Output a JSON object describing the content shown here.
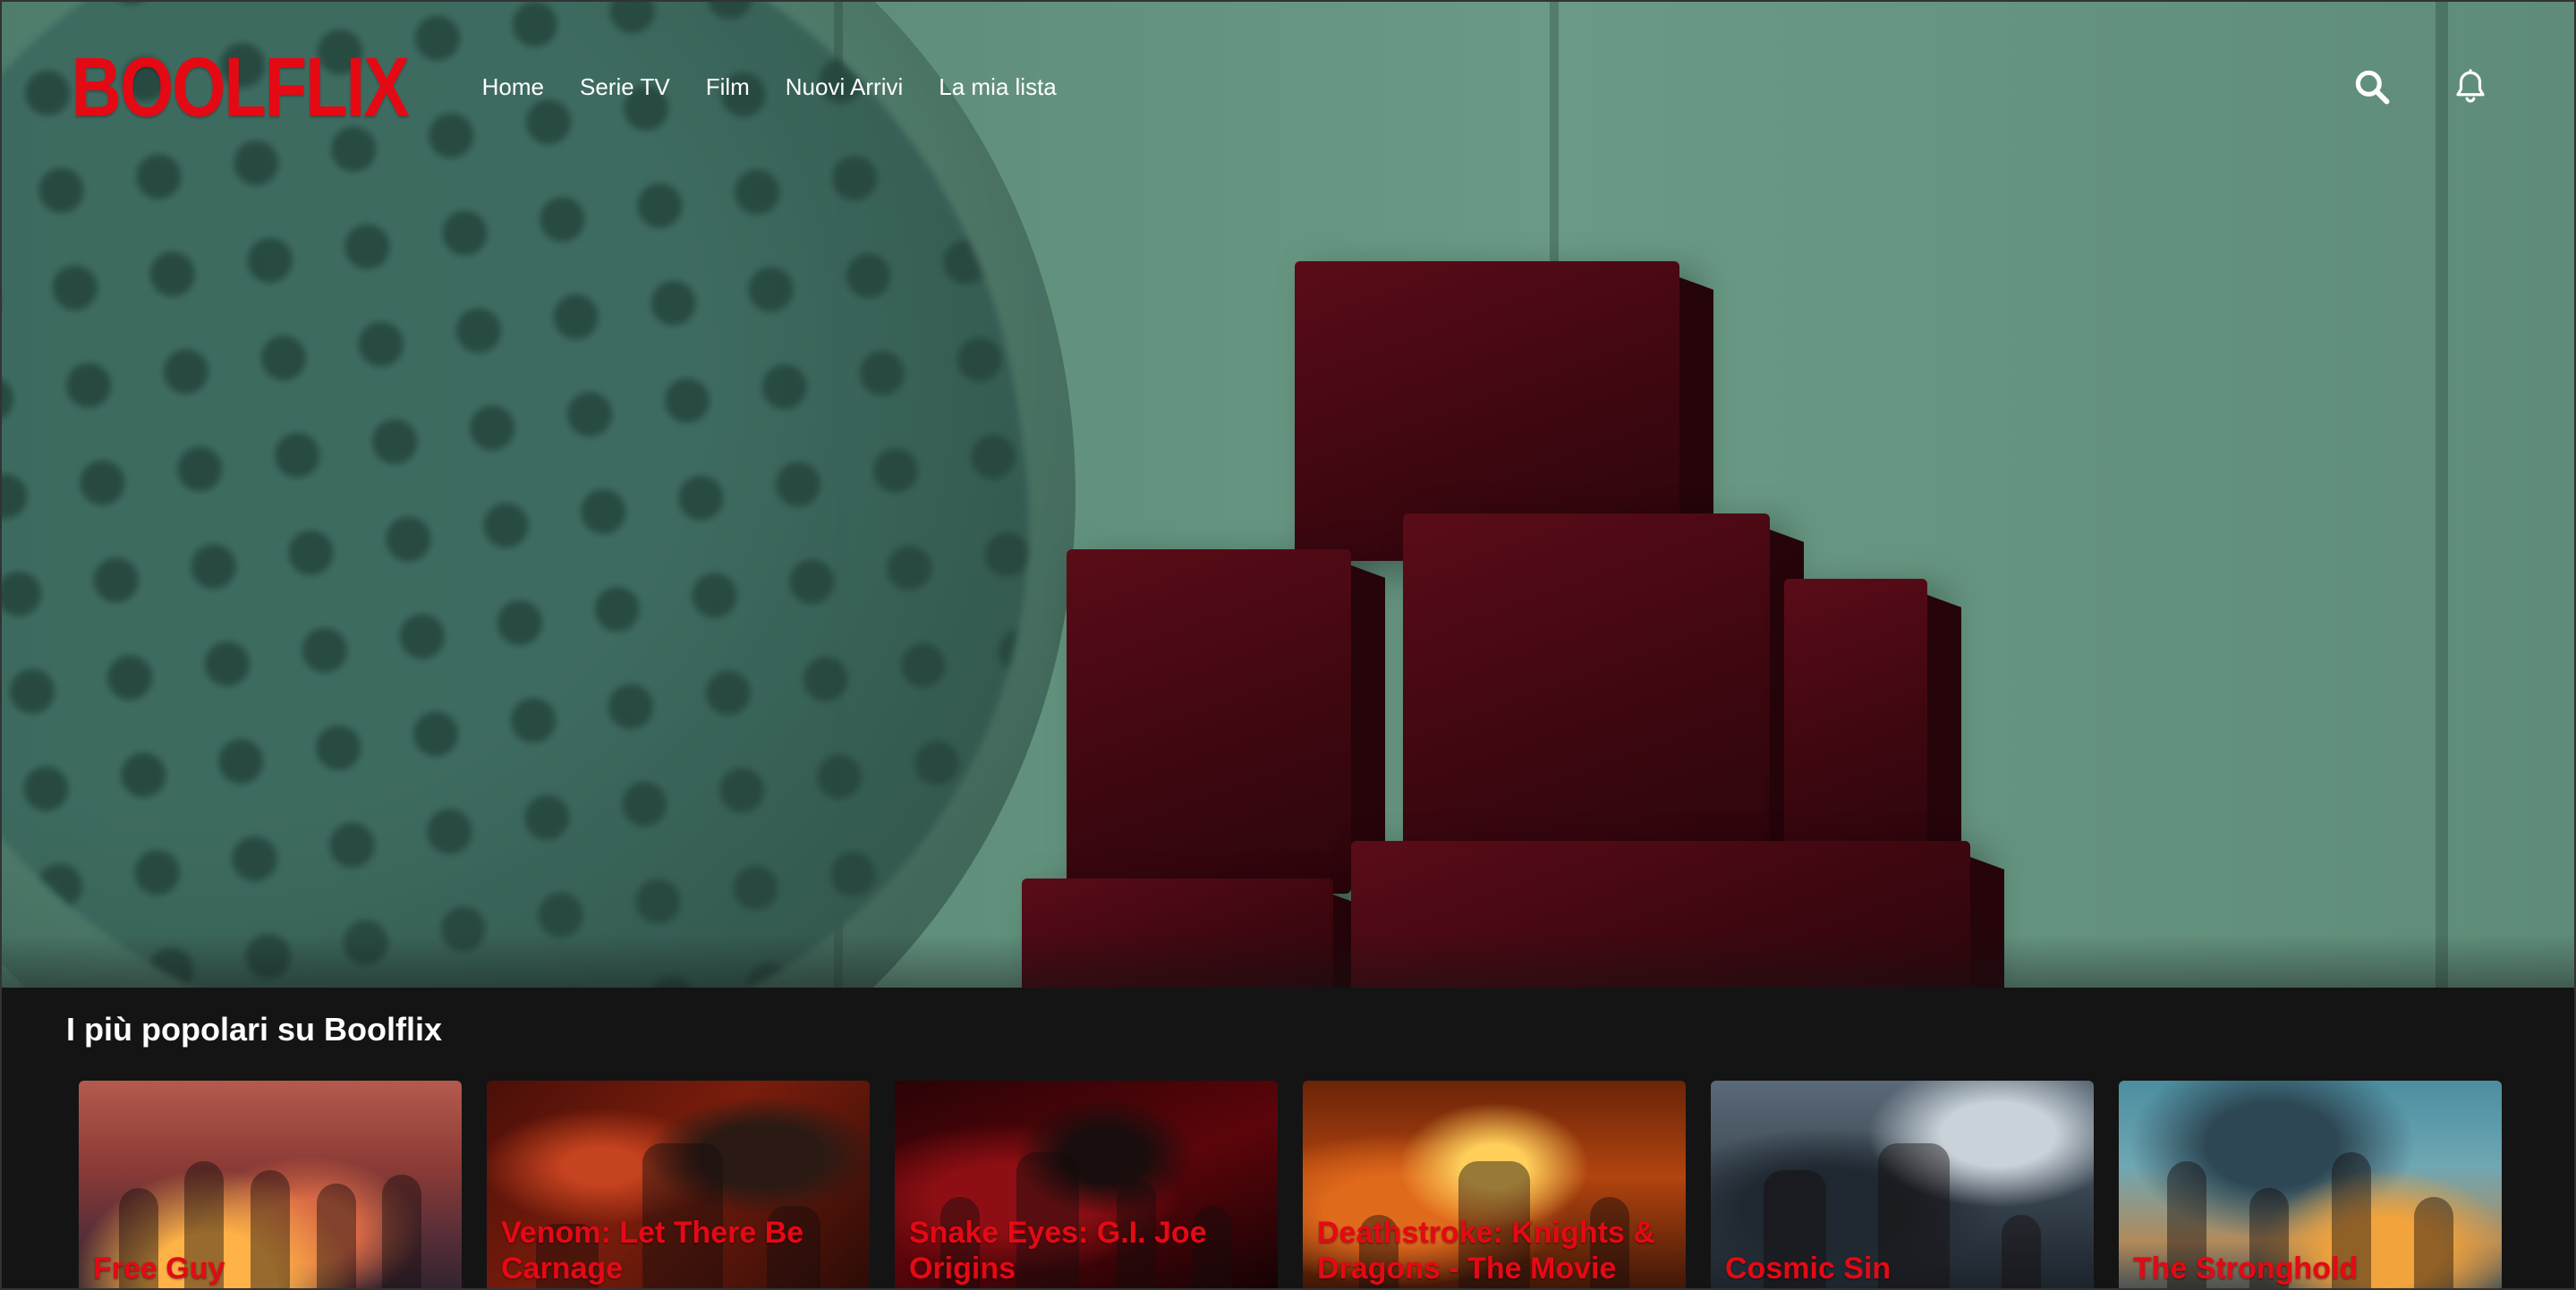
{
  "app": {
    "logo_text": "BOOLFLIX",
    "brand_color": "#e50914",
    "background_color": "#141414"
  },
  "nav": {
    "links": [
      {
        "label": "Home"
      },
      {
        "label": "Serie TV"
      },
      {
        "label": "Film"
      },
      {
        "label": "Nuovi Arrivi"
      },
      {
        "label": "La mia lista"
      }
    ],
    "icons": {
      "search": "search-icon",
      "notifications": "bell-icon"
    }
  },
  "popular": {
    "title": "I più popolari su Boolflix",
    "items": [
      {
        "title": "Free Guy"
      },
      {
        "title": "Venom: Let There Be Carnage"
      },
      {
        "title": "Snake Eyes: G.I. Joe Origins"
      },
      {
        "title": "Deathstroke: Knights & Dragons - The Movie"
      },
      {
        "title": "Cosmic Sin"
      },
      {
        "title": "The Stronghold"
      }
    ]
  }
}
